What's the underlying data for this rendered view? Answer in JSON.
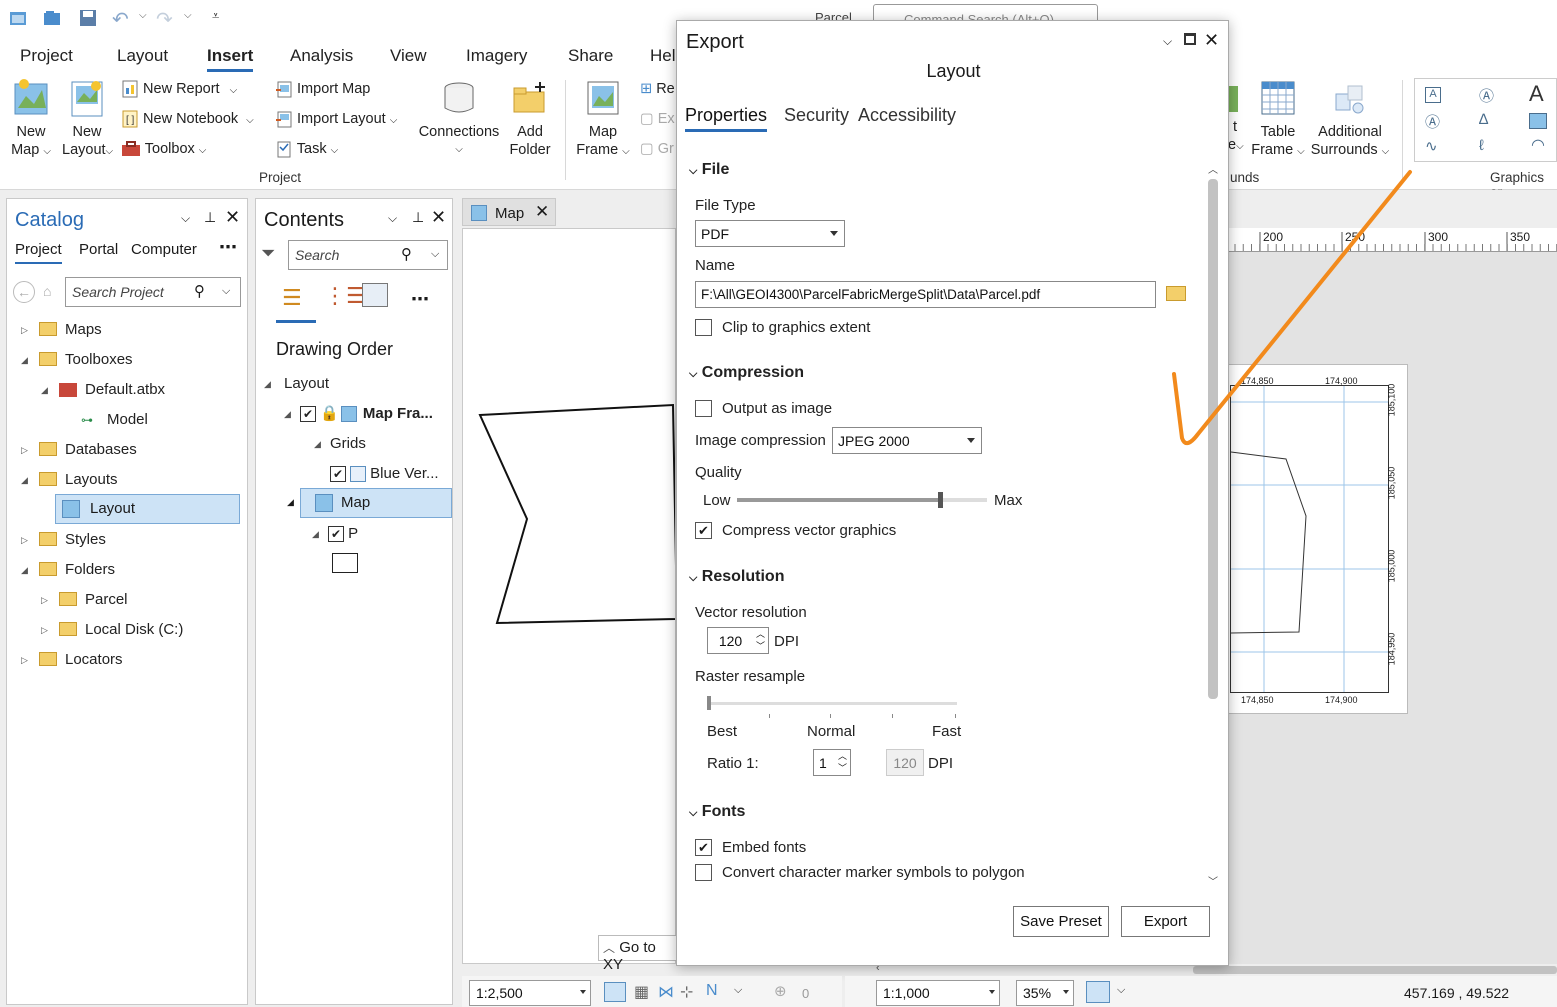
{
  "titlebar": {
    "project_name": "Parcel",
    "command_search_placeholder": "Command Search (Alt+Q)"
  },
  "menus": [
    "Project",
    "Layout",
    "Insert",
    "Analysis",
    "View",
    "Imagery",
    "Share",
    "Hel"
  ],
  "active_menu": "Insert",
  "ribbon": {
    "new_map": "New",
    "new_map2": "Map",
    "new_layout": "New",
    "new_layout2": "Layout",
    "new_report": "New Report",
    "new_notebook": "New Notebook",
    "toolbox": "Toolbox",
    "import_map": "Import Map",
    "import_layout": "Import Layout",
    "task": "Task",
    "connections": "Connections",
    "add_folder": "Add",
    "add_folder2": "Folder",
    "map_frame": "Map",
    "map_frame2": "Frame",
    "re": "Re",
    "ex": "Ex",
    "gr": "Gr",
    "table_frame": "Table",
    "table_frame2": "Frame",
    "add_surr": "Additional",
    "add_surr2": "Surrounds",
    "t_part": "t",
    "e_part": "e",
    "group_project": "Project",
    "group_surrounds": "unds",
    "group_graphics": "Graphics ar"
  },
  "catalog": {
    "title": "Catalog",
    "tabs": [
      "Project",
      "Portal",
      "Computer"
    ],
    "search_placeholder": "Search Project",
    "items": [
      "Maps",
      "Toolboxes",
      "Default.atbx",
      "Model",
      "Databases",
      "Layouts",
      "Layout",
      "Styles",
      "Folders",
      "Parcel",
      "Local Disk (C:)",
      "Locators"
    ]
  },
  "contents": {
    "title": "Contents",
    "search_placeholder": "Search",
    "heading": "Drawing Order",
    "items": [
      "Layout",
      "Map Fra...",
      "Grids",
      "Blue Ver...",
      "Map",
      "P"
    ]
  },
  "map_view": {
    "tab": "Map",
    "goto": "Go to XY",
    "scale": "1:2,500",
    "zero": "0"
  },
  "dialog": {
    "title": "Export",
    "subtitle": "Layout",
    "tabs": [
      "Properties",
      "Security",
      "Accessibility"
    ],
    "file_section": "File",
    "file_type_label": "File Type",
    "file_type": "PDF",
    "name_label": "Name",
    "name_value": "F:\\All\\GEOI4300\\ParcelFabricMergeSplit\\Data\\Parcel.pdf",
    "clip": "Clip to graphics extent",
    "compression_section": "Compression",
    "output_image": "Output as image",
    "image_compression_label": "Image compression",
    "image_compression": "JPEG 2000",
    "quality_label": "Quality",
    "low": "Low",
    "max": "Max",
    "quality_level": 0.81,
    "compress_vector": "Compress vector graphics",
    "resolution_section": "Resolution",
    "vector_res_label": "Vector resolution",
    "vector_res": "120",
    "dpi": "DPI",
    "raster_label": "Raster resample",
    "best": "Best",
    "normal": "Normal",
    "fast": "Fast",
    "ratio_label": "Ratio 1:",
    "ratio": "1",
    "ratio_dpi": "120",
    "fonts_section": "Fonts",
    "embed_fonts": "Embed fonts",
    "convert_markers": "Convert character marker symbols to polygon",
    "save_preset": "Save Preset",
    "export": "Export"
  },
  "layout_view": {
    "ruler": [
      "200",
      "250",
      "300",
      "350"
    ],
    "top_ticks": [
      "174,850",
      "174,900"
    ],
    "bottom_ticks": [
      "174,850",
      "174,900"
    ],
    "side_ticks": [
      "185,100",
      "185,050",
      "185,000",
      "184,950"
    ],
    "scale": "1:1,000",
    "zoom": "35%",
    "coords": "457.169 , 49.522"
  }
}
